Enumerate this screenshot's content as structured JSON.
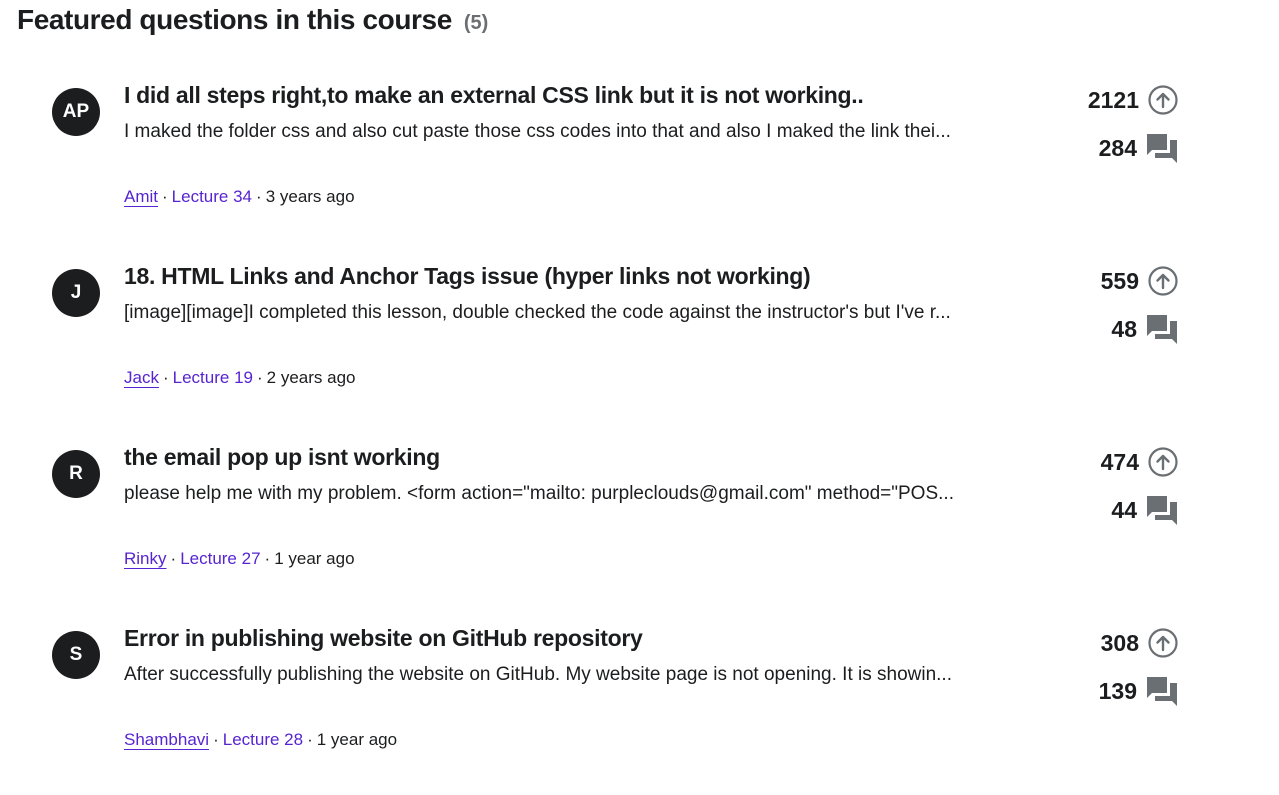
{
  "section": {
    "title": "Featured questions in this course",
    "count": "(5)"
  },
  "questions": [
    {
      "avatar_initials": "AP",
      "title": "I did all steps right,to make an external CSS link but it is not working..",
      "body": "I maked the folder css and also cut paste those css codes into  that and also I maked the link thei...",
      "author": "Amit",
      "lecture": "Lecture 34",
      "time": "3 years ago",
      "votes": "2121",
      "replies": "284"
    },
    {
      "avatar_initials": "J",
      "title": "18. HTML Links and Anchor Tags issue (hyper links not working)",
      "body": "[image][image]I completed this lesson, double checked the code against the instructor's but I've r...",
      "author": "Jack",
      "lecture": "Lecture 19",
      "time": "2 years ago",
      "votes": "559",
      "replies": "48"
    },
    {
      "avatar_initials": "R",
      "title": "the email pop up isnt working",
      "body": "please help me with my problem. <form action=\"mailto: purpleclouds@gmail.com\" method=\"POS...",
      "author": "Rinky",
      "lecture": "Lecture 27",
      "time": "1 year ago",
      "votes": "474",
      "replies": "44"
    },
    {
      "avatar_initials": "S",
      "title": "Error in publishing website on GitHub repository",
      "body": "After successfully publishing the website on GitHub. My website page is not opening. It is showin...",
      "author": "Shambhavi",
      "lecture": "Lecture 28",
      "time": "1 year ago",
      "votes": "308",
      "replies": "139"
    }
  ],
  "meta_separator": "·",
  "icons": {
    "upvote": "arrow-up-circle-icon",
    "replies": "chat-bubbles-icon"
  },
  "colors": {
    "text": "#1c1d1f",
    "link": "#5624d0",
    "muted": "#6a6f73",
    "icon": "#6a6f73"
  }
}
